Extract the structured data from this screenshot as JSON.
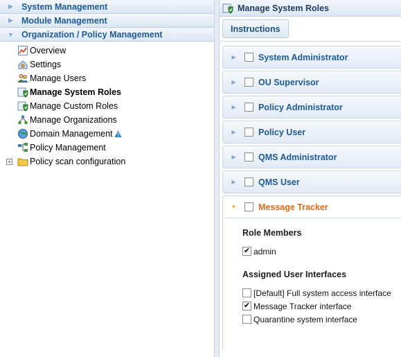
{
  "nav": {
    "accordions": [
      {
        "label": "System Management"
      },
      {
        "label": "Module Management"
      },
      {
        "label": "Organization / Policy Management"
      }
    ],
    "tree": [
      {
        "label": "Overview",
        "icon": "chart-icon"
      },
      {
        "label": "Settings",
        "icon": "settings-icon"
      },
      {
        "label": "Manage Users",
        "icon": "users-icon"
      },
      {
        "label": "Manage System Roles",
        "icon": "shield-icon",
        "selected": true
      },
      {
        "label": "Manage Custom Roles",
        "icon": "shield-icon"
      },
      {
        "label": "Manage Organizations",
        "icon": "organization-icon"
      },
      {
        "label": "Domain Management",
        "icon": "domain-icon",
        "warning": true
      },
      {
        "label": "Policy Management",
        "icon": "policy-icon"
      },
      {
        "label": "Policy scan configuration",
        "icon": "folder-icon",
        "expandable": true
      }
    ]
  },
  "panel": {
    "title": "Manage System Roles",
    "instructions_label": "Instructions",
    "roles": [
      {
        "label": "System Administrator",
        "checked": false
      },
      {
        "label": "OU Supervisor",
        "checked": false
      },
      {
        "label": "Policy Administrator",
        "checked": false
      },
      {
        "label": "Policy User",
        "checked": false
      },
      {
        "label": "QMS Administrator",
        "checked": false
      },
      {
        "label": "QMS User",
        "checked": false
      },
      {
        "label": "Message Tracker",
        "checked": false,
        "expanded": true
      }
    ],
    "expanded_role": {
      "members_heading": "Role Members",
      "members": [
        {
          "label": "admin",
          "checked": true
        }
      ],
      "interfaces_heading": "Assigned User Interfaces",
      "interfaces": [
        {
          "label": "[Default] Full system access interface",
          "checked": false
        },
        {
          "label": "Message Tracker interface",
          "checked": true
        },
        {
          "label": "Quarantine system interface",
          "checked": false
        }
      ]
    }
  },
  "colors": {
    "link_blue": "#1e5a96",
    "active_orange": "#e06a1a",
    "header_gradient_top": "#f3f7fb",
    "header_gradient_bottom": "#dce7f2"
  }
}
